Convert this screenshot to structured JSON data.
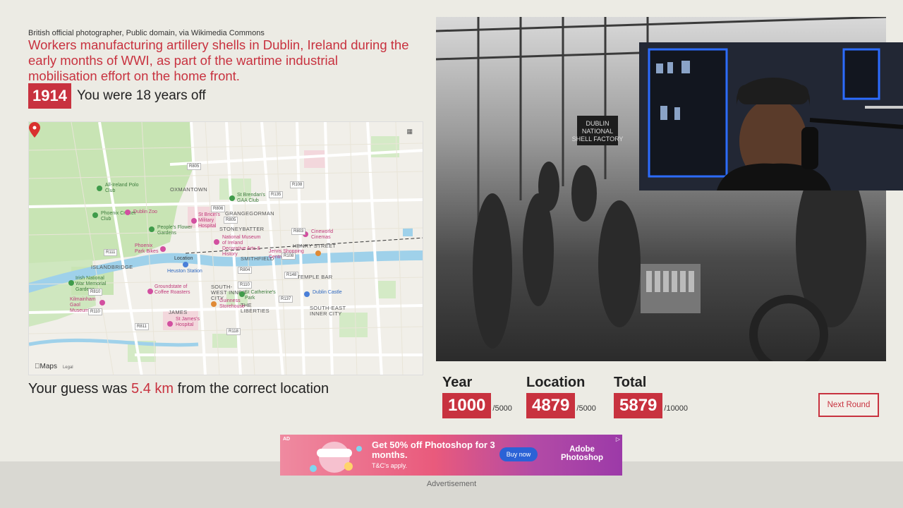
{
  "credit": "British official photographer, Public domain, via Wikimedia Commons",
  "caption": "Workers manufacturing artillery shells in Dublin, Ireland during the early months of WWI, as part of the wartime industrial mobilisation effort on the home front.",
  "answer": {
    "year": "1914",
    "years_off_text": "You were 18 years off"
  },
  "map": {
    "provider": "Maps",
    "legal": "Legal",
    "mode_icon": "map-mode-icon",
    "pin_label": "Location",
    "labels": {
      "oxmantown": "OXMANTOWN",
      "grangegorman": "GRANGEGORMAN",
      "stoneybatter": "STONEYBATTER",
      "smithfield": "SMITHFIELD",
      "islandbridge": "ISLANDBRIDGE",
      "temple_bar": "TEMPLE BAR",
      "southwest_inner_city": "SOUTH-WEST INNER CITY",
      "southeast_inner_city": "SOUTH-EAST INNER CITY",
      "the_liberties": "THE LIBERTIES",
      "james": "JAMES",
      "henry_street": "HENRY STREET",
      "all_ireland_polo": "All-Ireland Polo Club",
      "phoenix_cricket": "Phoenix Cricket Club",
      "dublin_zoo": "Dublin Zoo",
      "peoples_flower": "People's Flower Gardens",
      "phoenix_park_bikes": "Phoenix Park Bikes",
      "st_brendans": "St Brendan's GAA Club",
      "st_bricins": "St Bricin's Military Hospital",
      "national_museum": "National Museum of Ireland Decorative Arts & History",
      "cineworld": "Cineworld Cinemas",
      "jervis": "Jervis Shopping Centre",
      "heuston": "Heuston Station",
      "irish_war_memorial": "Irish National War Memorial Gardens",
      "kilmainham": "Kilmainham Gaol Museum",
      "roasters": "Irish Roasters",
      "groundstate": "Groundstate of Coffee Roasters",
      "guinness": "Guinness Storehouse",
      "st_catherines": "St Catherine's Park",
      "dublin_castle": "Dublin Castle",
      "st_james_hospital": "St James's Hospital"
    },
    "roads": [
      "R805",
      "R108",
      "R135",
      "R806",
      "R805",
      "R803",
      "R111",
      "R804",
      "R148",
      "R108",
      "R810",
      "R110",
      "R137",
      "R811",
      "R110",
      "R118"
    ]
  },
  "guess": {
    "prefix": "Your guess was ",
    "distance": "5.4 km",
    "suffix": " from the correct location"
  },
  "scores": {
    "year": {
      "label": "Year",
      "value": "1000",
      "max": "/5000"
    },
    "location": {
      "label": "Location",
      "value": "4879",
      "max": "/5000"
    },
    "total": {
      "label": "Total",
      "value": "5879",
      "max": "/10000"
    }
  },
  "next_button": "Next Round",
  "photo_sign": "DUBLIN NATIONAL SHELL FACTORY",
  "ad": {
    "tag": "AD",
    "title": "Get 50% off Photoshop for 3 months.",
    "sub": "T&C's apply.",
    "cta": "Buy now",
    "brand": "Adobe Photoshop",
    "label": "Advertisement"
  },
  "colors": {
    "accent": "#c8323f",
    "background": "#ecebe4",
    "ad_button": "#2b62d6"
  }
}
